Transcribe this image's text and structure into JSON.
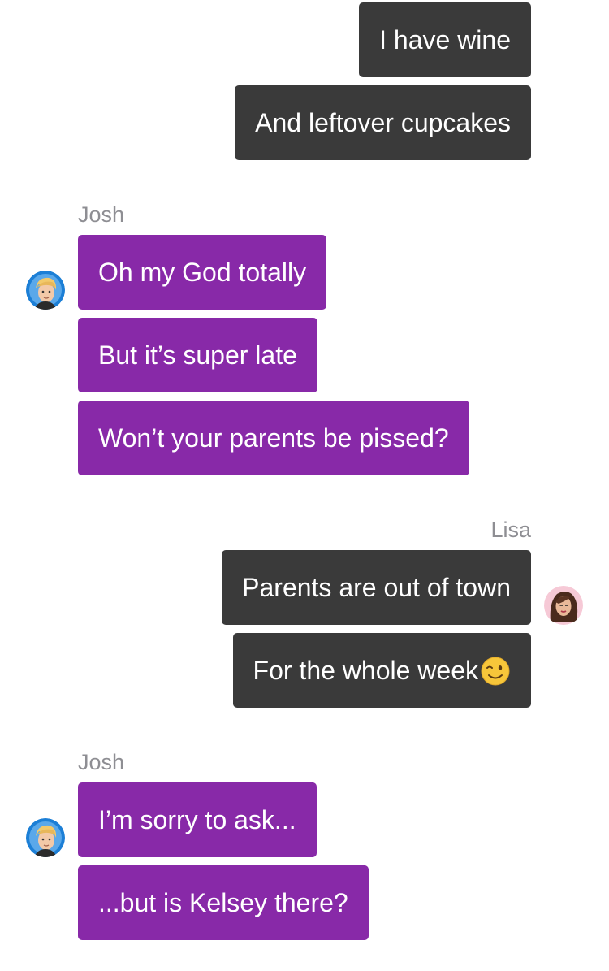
{
  "colors": {
    "outgoing_bubble": "#3a3a3a",
    "incoming_bubble": "#8829a8",
    "sender_name": "#8e8e93",
    "text": "#ffffff"
  },
  "groups": [
    {
      "direction": "outgoing",
      "messages": [
        {
          "text": "I have wine"
        },
        {
          "text": "And leftover cupcakes"
        }
      ]
    },
    {
      "direction": "incoming",
      "sender": "Josh",
      "avatar": "josh-avatar",
      "messages": [
        {
          "text": "Oh my God totally"
        },
        {
          "text": "But it’s super late"
        },
        {
          "text": "Won’t your parents be pissed?"
        }
      ]
    },
    {
      "direction": "outgoing",
      "sender": "Lisa",
      "avatar": "lisa-avatar",
      "messages": [
        {
          "text": "Parents are out of town"
        },
        {
          "text": "For the whole week",
          "emoji": "winking-face-emoji"
        }
      ]
    },
    {
      "direction": "incoming",
      "sender": "Josh",
      "avatar": "josh-avatar",
      "messages": [
        {
          "text": "I’m sorry to ask..."
        },
        {
          "text": "...but is Kelsey there?"
        }
      ]
    }
  ]
}
